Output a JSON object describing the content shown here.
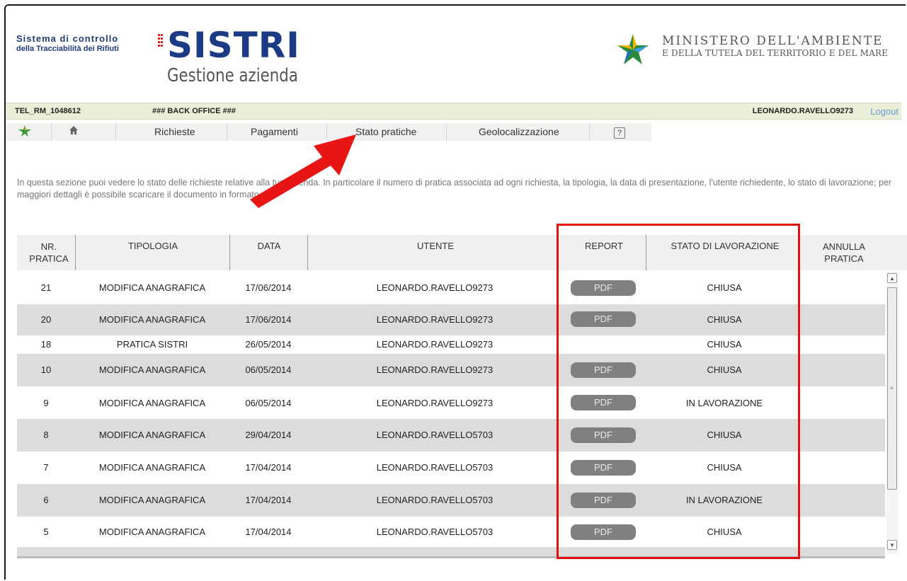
{
  "header": {
    "brand_line1": "Sistema di controllo",
    "brand_line2": "della Tracciabilità dei Rifiuti",
    "brand_name": "SISTRI",
    "subtitle": "Gestione azienda",
    "ministry_line1": "MINISTERO DELL'AMBIENTE",
    "ministry_line2": "E DELLA TUTELA DEL TERRITORIO E DEL MARE"
  },
  "infobar": {
    "code": "TEL_RM_1048612",
    "back_office": "### BACK OFFICE ###",
    "user": "LEONARDO.RAVELLO9273",
    "logout": "Logout"
  },
  "nav": {
    "items": [
      "Richieste",
      "Pagamenti",
      "Stato pratiche",
      "Geolocalizzazione"
    ],
    "help": "?"
  },
  "description": "In questa sezione puoi vedere lo stato delle richieste relative alla tua azienda. In particolare il numero di pratica associata ad ogni richiesta, la tipologia, la data di presentazione, l'utente richiedente, lo stato di lavorazione; per maggiori dettagli è possibile scaricare il documento in formato pdf.",
  "table": {
    "headers": {
      "nr_line1": "NR.",
      "nr_line2": "PRATICA",
      "tipologia": "TIPOLOGIA",
      "data": "DATA",
      "utente": "UTENTE",
      "report": "REPORT",
      "stato": "STATO DI LAVORAZIONE",
      "annulla_line1": "ANNULLA",
      "annulla_line2": "PRATICA"
    },
    "pdf_label": "PDF",
    "rows": [
      {
        "nr": "21",
        "tipologia": "MODIFICA ANAGRAFICA",
        "data": "17/06/2014",
        "utente": "LEONARDO.RAVELLO9273",
        "report": "PDF",
        "stato": "CHIUSA"
      },
      {
        "nr": "20",
        "tipologia": "MODIFICA ANAGRAFICA",
        "data": "17/06/2014",
        "utente": "LEONARDO.RAVELLO9273",
        "report": "PDF",
        "stato": "CHIUSA"
      },
      {
        "nr": "18",
        "tipologia": "PRATICA SISTRI",
        "data": "26/05/2014",
        "utente": "LEONARDO.RAVELLO9273",
        "report": "",
        "stato": "CHIUSA"
      },
      {
        "nr": "10",
        "tipologia": "MODIFICA ANAGRAFICA",
        "data": "06/05/2014",
        "utente": "LEONARDO.RAVELLO9273",
        "report": "PDF",
        "stato": "CHIUSA"
      },
      {
        "nr": "9",
        "tipologia": "MODIFICA ANAGRAFICA",
        "data": "06/05/2014",
        "utente": "LEONARDO.RAVELLO9273",
        "report": "PDF",
        "stato": "IN LAVORAZIONE"
      },
      {
        "nr": "8",
        "tipologia": "MODIFICA ANAGRAFICA",
        "data": "29/04/2014",
        "utente": "LEONARDO.RAVELLO5703",
        "report": "PDF",
        "stato": "CHIUSA"
      },
      {
        "nr": "7",
        "tipologia": "MODIFICA ANAGRAFICA",
        "data": "17/04/2014",
        "utente": "LEONARDO.RAVELLO5703",
        "report": "PDF",
        "stato": "CHIUSA"
      },
      {
        "nr": "6",
        "tipologia": "MODIFICA ANAGRAFICA",
        "data": "17/04/2014",
        "utente": "LEONARDO.RAVELLO5703",
        "report": "PDF",
        "stato": "IN LAVORAZIONE"
      },
      {
        "nr": "5",
        "tipologia": "MODIFICA ANAGRAFICA",
        "data": "17/04/2014",
        "utente": "LEONARDO.RAVELLO5703",
        "report": "PDF",
        "stato": "CHIUSA"
      }
    ]
  },
  "colors": {
    "brand_blue": "#1b3c84",
    "infobar_bg": "#e8eed8",
    "logout_link": "#6a9ad0",
    "pdf_button": "#808080",
    "annotation_red": "#e01010"
  }
}
